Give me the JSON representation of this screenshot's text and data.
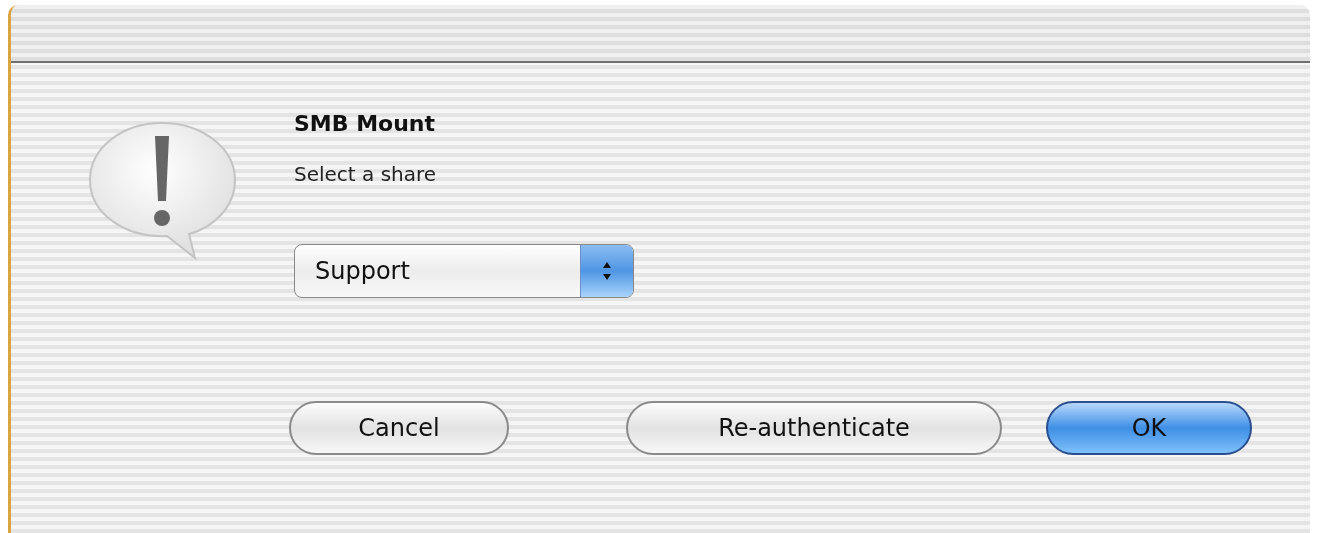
{
  "dialog": {
    "title": "SMB Mount",
    "message": "Select a share"
  },
  "share_popup": {
    "value": "Support"
  },
  "buttons": [
    {
      "label": "Cancel",
      "default": false
    },
    {
      "label": "Re-authenticate",
      "default": false
    },
    {
      "label": "OK",
      "default": true
    }
  ]
}
